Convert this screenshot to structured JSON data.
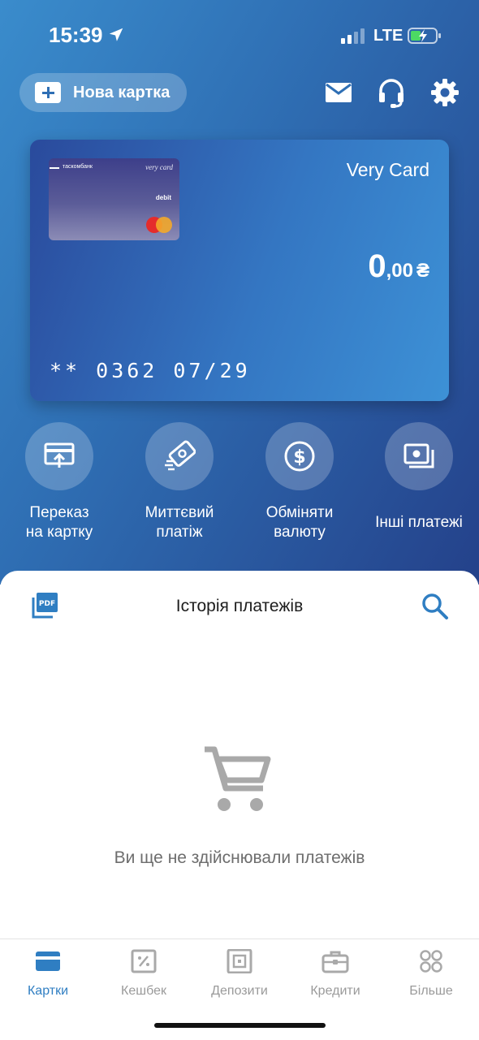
{
  "status": {
    "time": "15:39",
    "network": "LTE"
  },
  "header": {
    "new_card_label": "Нова картка"
  },
  "card": {
    "mini_bank": "таскомбанк",
    "mini_brand": "very card",
    "mini_type": "debit",
    "name": "Very Card",
    "balance_int": "0",
    "balance_dec": ",00",
    "currency": "₴",
    "number": "** 0362 07/29"
  },
  "actions": [
    {
      "label": "Переказ\nна картку",
      "icon": "card-transfer-icon"
    },
    {
      "label": "Миттєвий\nплатіж",
      "icon": "instant-payment-icon"
    },
    {
      "label": "Обміняти\nвалюту",
      "icon": "currency-exchange-icon"
    },
    {
      "label": "Інші платежі",
      "icon": "other-payments-icon"
    }
  ],
  "history": {
    "title": "Історія платежів",
    "empty_text": "Ви ще не здійснювали платежів"
  },
  "tabs": [
    {
      "label": "Картки",
      "active": true
    },
    {
      "label": "Кешбек",
      "active": false
    },
    {
      "label": "Депозити",
      "active": false
    },
    {
      "label": "Кредити",
      "active": false
    },
    {
      "label": "Більше",
      "active": false
    }
  ],
  "colors": {
    "accent": "#2f7ec2",
    "gradient_start": "#3a8ccc",
    "gradient_end": "#24418a"
  }
}
